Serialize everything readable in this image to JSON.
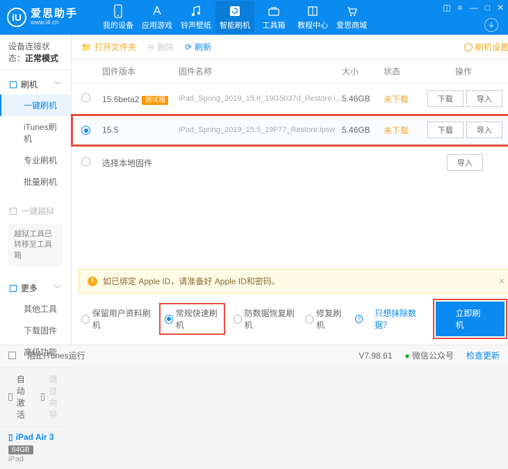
{
  "header": {
    "app_name": "爱思助手",
    "app_url": "www.i4.cn",
    "logo_letter": "iU"
  },
  "nav": [
    {
      "label": "我的设备"
    },
    {
      "label": "应用游戏"
    },
    {
      "label": "铃声壁纸"
    },
    {
      "label": "智能刷机",
      "active": true
    },
    {
      "label": "工具箱"
    },
    {
      "label": "教程中心"
    },
    {
      "label": "爱思商城"
    }
  ],
  "sidebar": {
    "conn_label": "设备连接状态：",
    "conn_value": "正常模式",
    "flash_header": "刷机",
    "flash_items": [
      "一键刷机",
      "iTunes刷机",
      "专业刷机",
      "批量刷机"
    ],
    "jailbreak_header": "一键越狱",
    "jailbreak_note": "越狱工具已转移至工具箱",
    "more_header": "更多",
    "more_items": [
      "其他工具",
      "下载固件",
      "高级功能"
    ],
    "auto_activate": "自动激活",
    "skip_guide": "跳过向导",
    "device_name": "iPad Air 3",
    "device_storage": "64GB",
    "device_type": "iPad"
  },
  "toolbar": {
    "open_folder": "打开文件夹",
    "delete": "删除",
    "refresh": "刷新",
    "settings": "刷机设置"
  },
  "table": {
    "headers": {
      "version": "固件版本",
      "name": "固件名称",
      "size": "大小",
      "status": "状态",
      "ops": "操作"
    },
    "rows": [
      {
        "version": "15.6beta2",
        "beta": "测试版",
        "name": "iPad_Spring_2019_15.6_19G5037d_Restore.i...",
        "size": "5.46GB",
        "status": "未下载",
        "selected": false,
        "highlighted": false
      },
      {
        "version": "15.5",
        "beta": "",
        "name": "iPad_Spring_2019_15.5_19F77_Restore.ipsw",
        "size": "5.46GB",
        "status": "未下载",
        "selected": true,
        "highlighted": true
      }
    ],
    "local_option": "选择本地固件",
    "btn_download": "下载",
    "btn_import": "导入"
  },
  "warn": {
    "text": "如已绑定 Apple ID，请准备好 Apple ID和密码。"
  },
  "modes": {
    "opt1": "保留用户资料刷机",
    "opt2": "常规快速刷机",
    "opt3": "防数据恢复刷机",
    "opt4": "修复刷机",
    "clear_link": "只想抹除数据？",
    "flash_btn": "立即刷机"
  },
  "footer": {
    "block_itunes": "阻止iTunes运行",
    "version": "V7.98.61",
    "wechat": "微信公众号",
    "check_update": "检查更新"
  }
}
